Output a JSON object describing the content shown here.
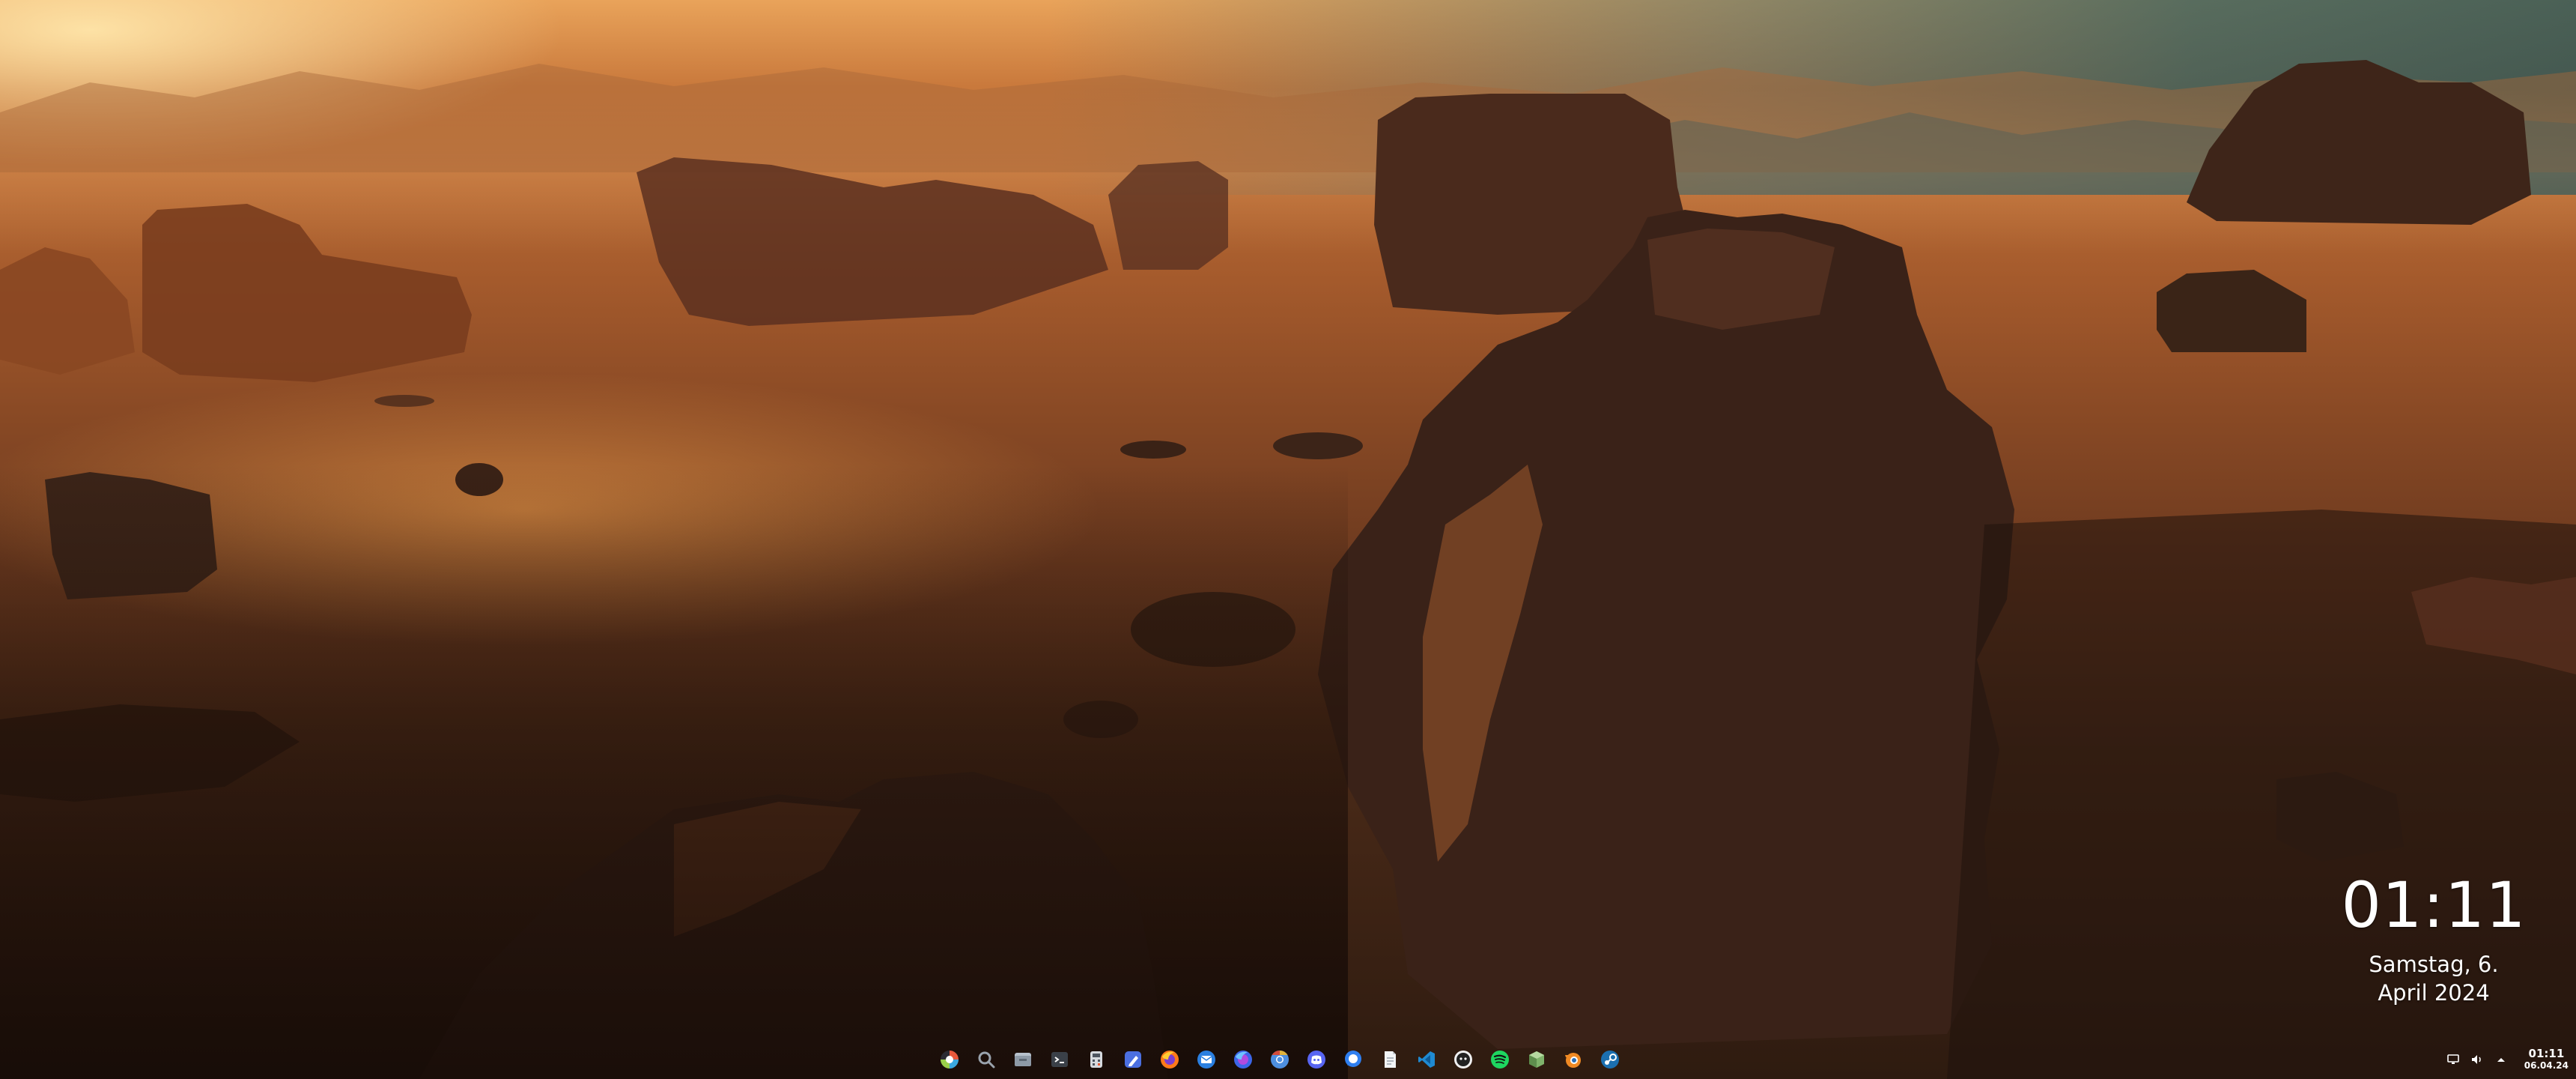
{
  "desktop": {
    "wallpaper": "desert-rock-landscape",
    "colors": {
      "sky_warm": "#e9a35a",
      "sky_cool": "#3b6e72",
      "sand": "#c77a3e",
      "rock": "#5a3421",
      "shadow": "#2a170d"
    }
  },
  "clock_widget": {
    "time": "01:11",
    "date_line1": "Samstag, 6.",
    "date_line2": "April 2024"
  },
  "taskbar": {
    "apps": [
      {
        "name": "launcher",
        "icon": "app-launcher-icon"
      },
      {
        "name": "search",
        "icon": "search-icon"
      },
      {
        "name": "files",
        "icon": "file-manager-icon"
      },
      {
        "name": "terminal",
        "icon": "terminal-icon"
      },
      {
        "name": "calculator",
        "icon": "calculator-icon"
      },
      {
        "name": "text-editor",
        "icon": "text-editor-icon"
      },
      {
        "name": "firefox",
        "icon": "firefox-icon"
      },
      {
        "name": "mail",
        "icon": "mail-icon"
      },
      {
        "name": "firefox-dev",
        "icon": "firefox-developer-icon"
      },
      {
        "name": "chromium",
        "icon": "chromium-icon"
      },
      {
        "name": "discord",
        "icon": "discord-icon"
      },
      {
        "name": "chat",
        "icon": "chat-icon"
      },
      {
        "name": "document",
        "icon": "document-icon"
      },
      {
        "name": "vscode",
        "icon": "vscode-icon"
      },
      {
        "name": "github",
        "icon": "github-icon"
      },
      {
        "name": "spotify",
        "icon": "spotify-icon"
      },
      {
        "name": "package",
        "icon": "package-icon"
      },
      {
        "name": "blender",
        "icon": "blender-icon"
      },
      {
        "name": "steam",
        "icon": "steam-icon"
      }
    ],
    "tray": {
      "icons": [
        "screen-icon",
        "volume-icon",
        "chevron-up-icon"
      ],
      "time": "01:11",
      "date": "06.04.24"
    }
  }
}
